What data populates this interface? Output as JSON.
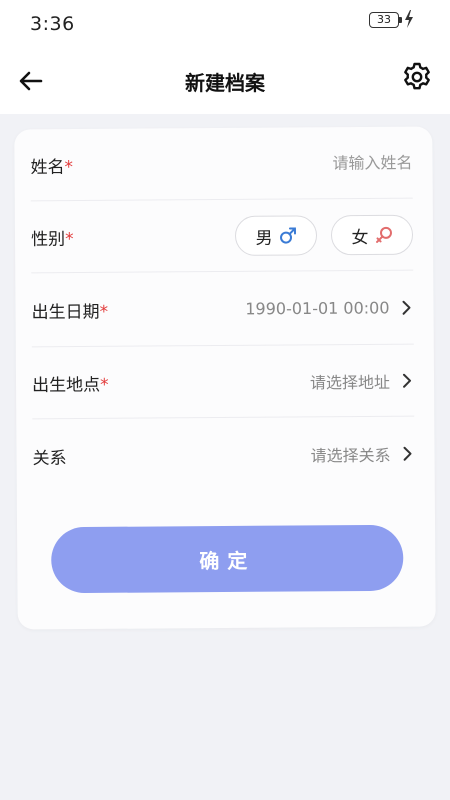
{
  "status_bar": {
    "time": "3:36",
    "battery": "33"
  },
  "header": {
    "title": "新建档案",
    "back_icon": "arrow-left-icon",
    "settings_icon": "gear-icon"
  },
  "form": {
    "name": {
      "label": "姓名",
      "required_mark": "*",
      "placeholder": "请输入姓名",
      "value": ""
    },
    "gender": {
      "label": "性别",
      "required_mark": "*",
      "male_label": "男",
      "female_label": "女",
      "male_color": "#3a7bd5",
      "female_color": "#e26d6d"
    },
    "birth_date": {
      "label": "出生日期",
      "required_mark": "*",
      "value": "1990-01-01 00:00"
    },
    "birth_place": {
      "label": "出生地点",
      "required_mark": "*",
      "value": "请选择地址"
    },
    "relation": {
      "label": "关系",
      "value": "请选择关系"
    }
  },
  "confirm_button": {
    "label": "确定",
    "color": "#8e9ef0"
  }
}
